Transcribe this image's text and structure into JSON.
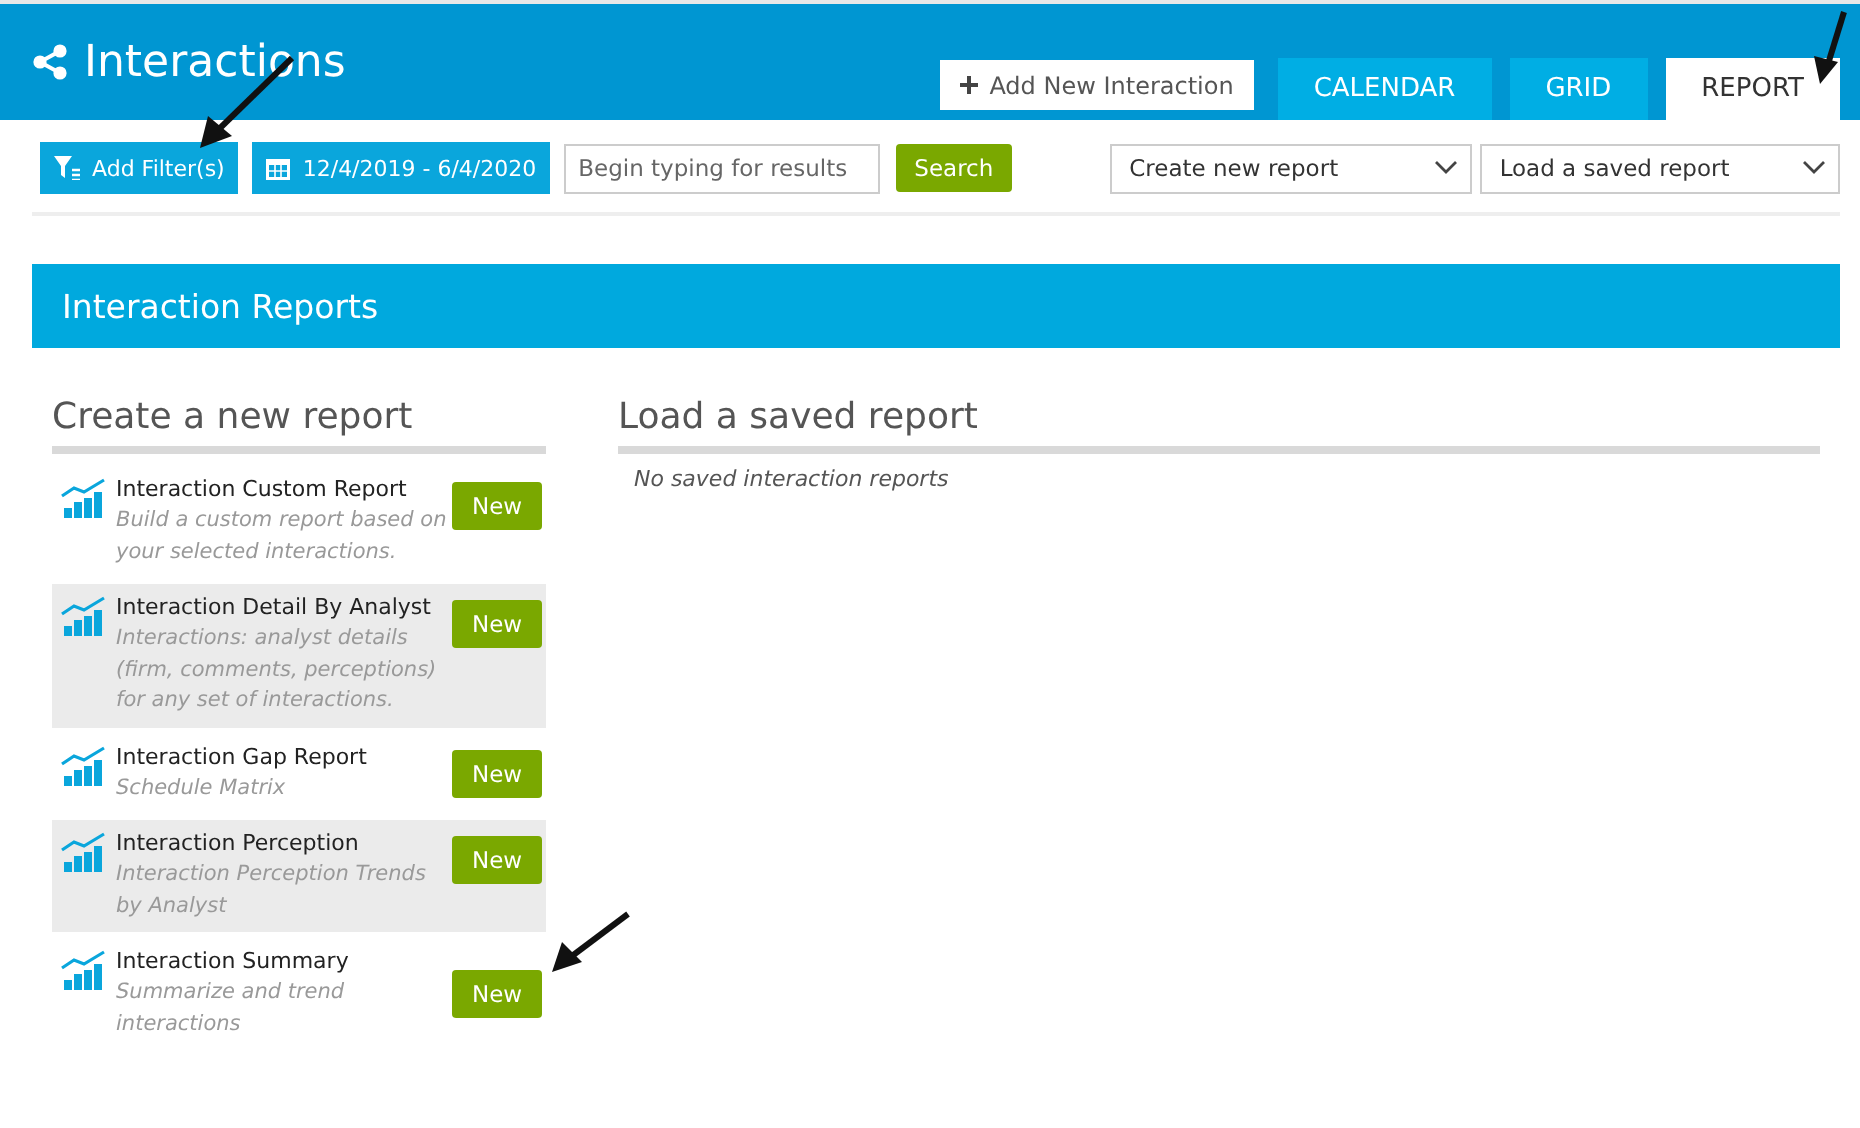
{
  "header": {
    "title": "Interactions",
    "add_button": "Add New Interaction"
  },
  "tabs": [
    {
      "label": "CALENDAR",
      "selected": false
    },
    {
      "label": "GRID",
      "selected": false
    },
    {
      "label": "REPORT",
      "selected": true
    }
  ],
  "toolbar": {
    "filter_button": "Add Filter(s)",
    "date_range": "12/4/2019 - 6/4/2020",
    "search": {
      "placeholder": "Begin typing for results"
    },
    "search_button": "Search",
    "create_select": "Create new report",
    "load_select": "Load a saved report"
  },
  "section": {
    "title": "Interaction Reports"
  },
  "create": {
    "heading": "Create a new report",
    "reports": [
      {
        "title": "Interaction Custom Report",
        "description": "Build a custom report based on your selected interactions.",
        "button": "New"
      },
      {
        "title": "Interaction Detail By Analyst",
        "description": "Interactions: analyst details (firm, comments, perceptions) for any set of interactions.",
        "button": "New"
      },
      {
        "title": "Interaction Gap Report",
        "description": "Schedule Matrix",
        "button": "New"
      },
      {
        "title": "Interaction Perception",
        "description": "Interaction Perception Trends by Analyst",
        "button": "New"
      },
      {
        "title": "Interaction Summary",
        "description": "Summarize and trend interactions",
        "button": "New"
      }
    ]
  },
  "saved": {
    "heading": "Load a saved report",
    "empty_text": "No saved interaction reports"
  }
}
